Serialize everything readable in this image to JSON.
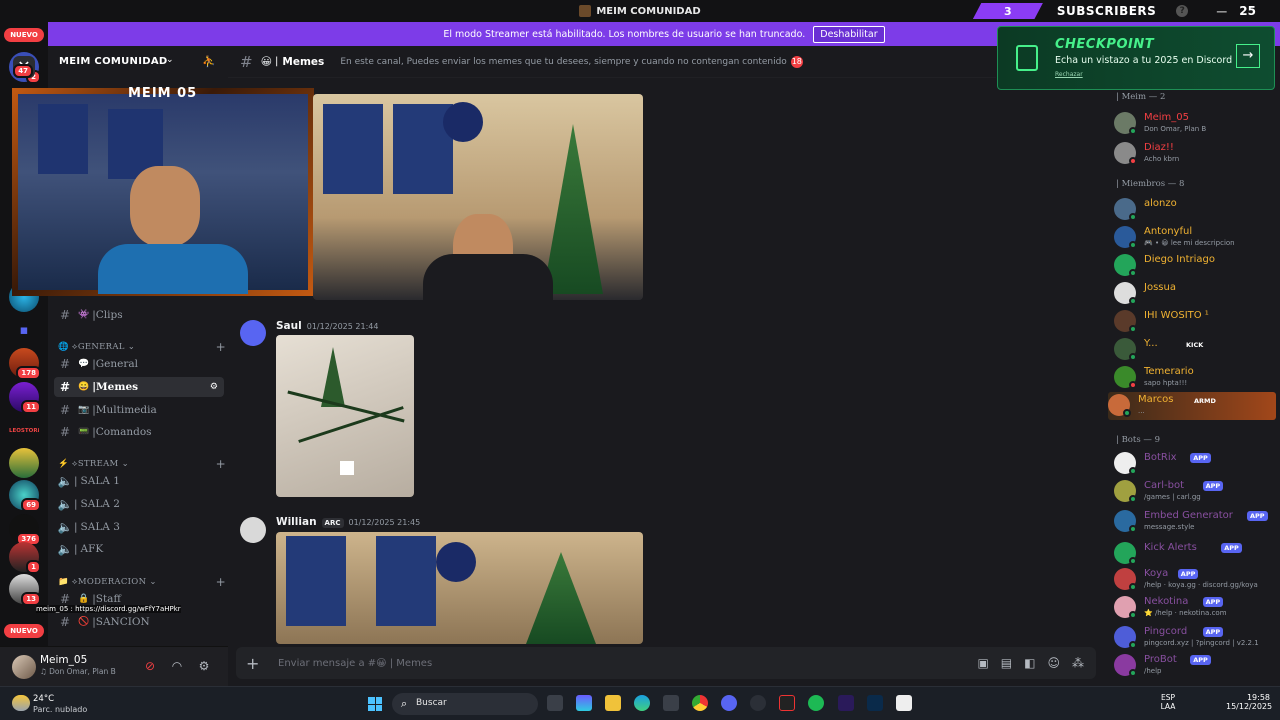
{
  "window": {
    "title": "MEIM COMUNIDAD"
  },
  "overlay": {
    "viewers": "3",
    "subs_label": "SUBSCRIBERS",
    "help": "?",
    "minimize": "—",
    "count": "25"
  },
  "banner": {
    "text": "El modo Streamer está habilitado. Los nombres de usuario se han truncado.",
    "button": "Deshabilitar"
  },
  "rail": {
    "nuevo_top": "NUEVO",
    "nuevo_bottom": "NUEVO",
    "badges": [
      "2",
      "47",
      "178",
      "11",
      "69",
      "376",
      "1",
      "13"
    ],
    "labels": [
      "LEOSTORE"
    ]
  },
  "server": {
    "name": "MEIM COMUNIDAD"
  },
  "channels": {
    "clips": "Clips",
    "cat_general": "GENERAL",
    "general": "General",
    "memes": "Memes",
    "multimedia": "Multimedia",
    "comandos": "Comandos",
    "cat_stream": "STREAM",
    "sala1": "SALA 1",
    "sala2": "SALA 2",
    "sala3": "SALA 3",
    "afk": "AFK",
    "cat_moderacion": "MODERACION",
    "staff": "Staff",
    "sancion": "SANCION"
  },
  "stream_overlay": {
    "title": "MEIM 05",
    "link_text": "meim_05 : https://discord.gg/wFfY7aHPkr"
  },
  "user": {
    "name": "Meim_05",
    "status": "Don Omar, Plan B"
  },
  "chat_header": {
    "channel": "Memes",
    "topic": "En este canal, Puedes enviar los memes que tu desees, siempre y cuando no contengan contenido",
    "topic_badge": "18"
  },
  "messages": [
    {
      "author": "Saul",
      "time": "01/12/2025 21:44"
    },
    {
      "author": "Willian",
      "tag": "ARC",
      "time": "01/12/2025 21:45"
    }
  ],
  "input": {
    "placeholder": "Enviar mensaje a #😀 | Memes"
  },
  "members": {
    "group_meim": "| Meim — 2",
    "group_members": "| Miembros — 8",
    "group_bots": "| Bots — 9",
    "list": [
      {
        "name": "Meim_05",
        "status": "Don Omar, Plan B",
        "color": "#f23f43"
      },
      {
        "name": "Diaz!!",
        "status": "Acho kbrn",
        "color": "#f23f43"
      },
      {
        "name": "alonzo",
        "status": "",
        "color": "#f0b232"
      },
      {
        "name": "Antonyful",
        "status": "🎮 • 😀 lee mi descripcion",
        "color": "#f0b232"
      },
      {
        "name": "Diego Intriago",
        "status": "",
        "color": "#f0b232"
      },
      {
        "name": "Jossua",
        "status": "",
        "color": "#f0b232"
      },
      {
        "name": "IHI WOSITO ¹",
        "status": "",
        "color": "#f0b232"
      },
      {
        "name": "Y...",
        "tag": "KICK",
        "status": "",
        "color": "#f0b232"
      },
      {
        "name": "Temerario",
        "status": "sapo hpta!!!",
        "color": "#f0b232"
      },
      {
        "name": "Marcos",
        "tag": "ARMD",
        "status": "...",
        "color": "#f0b232"
      },
      {
        "name": "BotRix",
        "status": "",
        "color": "#9b59b6"
      },
      {
        "name": "Carl-bot",
        "status": "/games | carl.gg",
        "color": "#9b59b6"
      },
      {
        "name": "Embed Generator",
        "status": "message.style",
        "color": "#9b59b6"
      },
      {
        "name": "Kick Alerts",
        "status": "",
        "color": "#9b59b6"
      },
      {
        "name": "Koya",
        "status": "/help · koya.gg · discord.gg/koya",
        "color": "#9b59b6"
      },
      {
        "name": "Nekotina",
        "status": "⭐ /help · nekotina.com",
        "color": "#9b59b6"
      },
      {
        "name": "Pingcord",
        "status": "pingcord.xyz | ?pingcord | v2.2.1",
        "color": "#9b59b6"
      },
      {
        "name": "ProBot",
        "status": "/help",
        "color": "#9b59b6"
      }
    ],
    "app_label": "APP"
  },
  "checkpoint": {
    "title": "CHECKPOINT",
    "subtitle": "Echa un vistazo a tu 2025 en Discord",
    "dismiss": "Rechazar",
    "arrow": "→"
  },
  "taskbar": {
    "temp": "24°C",
    "weather": "Parc. nublado",
    "search": "Buscar",
    "lang1": "ESP",
    "lang2": "LAA",
    "time": "19:58",
    "date": "15/12/2025"
  },
  "colors": {
    "accent": "#7d3ce8",
    "online": "#23a55a",
    "dnd": "#f23f43",
    "idle": "#f0b232"
  }
}
